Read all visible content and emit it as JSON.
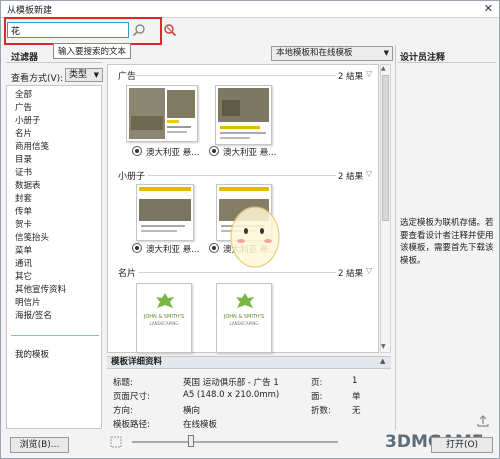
{
  "window": {
    "title": "从模板新建",
    "close_glyph": "✕"
  },
  "search": {
    "value": "花",
    "tooltip": "输入要搜索的文本"
  },
  "filters": {
    "title": "过滤器",
    "view_by_label": "查看方式(V):",
    "view_by_value": "类型",
    "items": [
      "全部",
      "广告",
      "小册子",
      "名片",
      "商用信笺",
      "目录",
      "证书",
      "数据表",
      "封套",
      "传单",
      "贺卡",
      "信笺抬头",
      "菜单",
      "通讯",
      "其它",
      "其他宣传资料",
      "明信片",
      "海报/签名"
    ],
    "my_templates": "我的模板",
    "browse_button": "浏览(B)..."
  },
  "source": {
    "selected": "本地模板和在线模板"
  },
  "categories": [
    {
      "name": "广告",
      "count": "2 結果",
      "authors": [
        "澳大利亚 悬...",
        "澳大利亚 悬..."
      ]
    },
    {
      "name": "小册子",
      "count": "2 結果",
      "authors": [
        "澳大利亚 悬...",
        "澳大利亚 悬..."
      ]
    },
    {
      "name": "名片",
      "count": "2 結果",
      "authors": []
    }
  ],
  "business_card": {
    "name_line": "JOHN & SMITH'S",
    "sub_line": "LANDSCAPING"
  },
  "details": {
    "title": "模板详细资料",
    "label_title": "标题:",
    "value_title": "英国 运动俱乐部 - 广告 1",
    "label_page_size": "页面尺寸:",
    "value_page_size": "A5 (148.0 x 210.0mm)",
    "label_orientation": "方向:",
    "value_orientation": "横向",
    "label_path": "模板路径:",
    "value_path": "在线模板",
    "label_pages": "页:",
    "value_pages": "1",
    "label_sides": "面:",
    "value_sides": "单",
    "label_fold": "折数:",
    "value_fold": "无"
  },
  "designer": {
    "title": "设计员注释",
    "text": "选定模板为联机存储。若要查看设计者注释并使用该模板，需要首先下载该模板。"
  },
  "footer": {
    "open_button": "打开(O)",
    "watermark": "3DMGAME"
  },
  "colors": {
    "highlight": "#e0262d",
    "input_border": "#2e9bd6",
    "leaf_green": "#7ab648"
  }
}
